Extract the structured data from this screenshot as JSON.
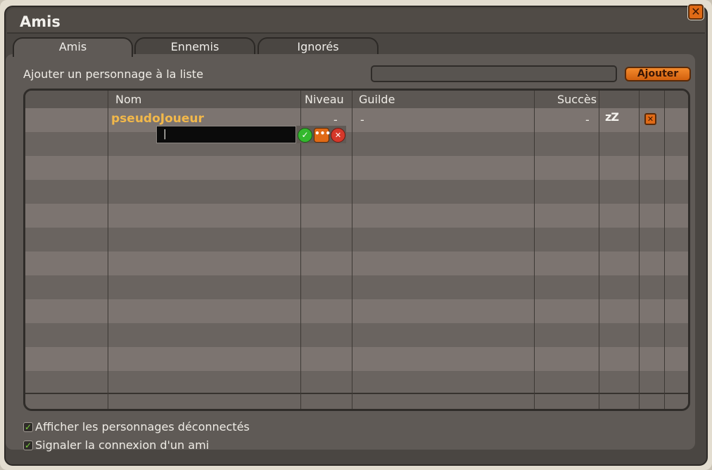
{
  "window": {
    "title": "Amis",
    "close_icon": "✕"
  },
  "tabs": [
    {
      "label": "Amis",
      "active": true
    },
    {
      "label": "Ennemis",
      "active": false
    },
    {
      "label": "Ignorés",
      "active": false
    }
  ],
  "add": {
    "label": "Ajouter un personnage à la liste",
    "input_value": "",
    "button_label": "Ajouter"
  },
  "table": {
    "columns": [
      "Nom",
      "Niveau",
      "Guilde",
      "Succès"
    ],
    "rows": [
      {
        "name": "pseudoJoueur",
        "level": "-",
        "guild": "-",
        "achievements": "-",
        "status_icon": "sleep-icon",
        "status_text": "zZ"
      }
    ]
  },
  "edit": {
    "value": "|",
    "ok_icon": "✓",
    "more_icon": "•••",
    "cancel_icon": "✕"
  },
  "options": [
    {
      "label": "Afficher les personnages déconnectés",
      "checked": true
    },
    {
      "label": "Signaler la connexion d'un ami",
      "checked": true
    }
  ],
  "colors": {
    "accent": "#e06a16",
    "name_color": "#f2b84a",
    "ok": "#33b82d",
    "cancel": "#d5382a"
  }
}
